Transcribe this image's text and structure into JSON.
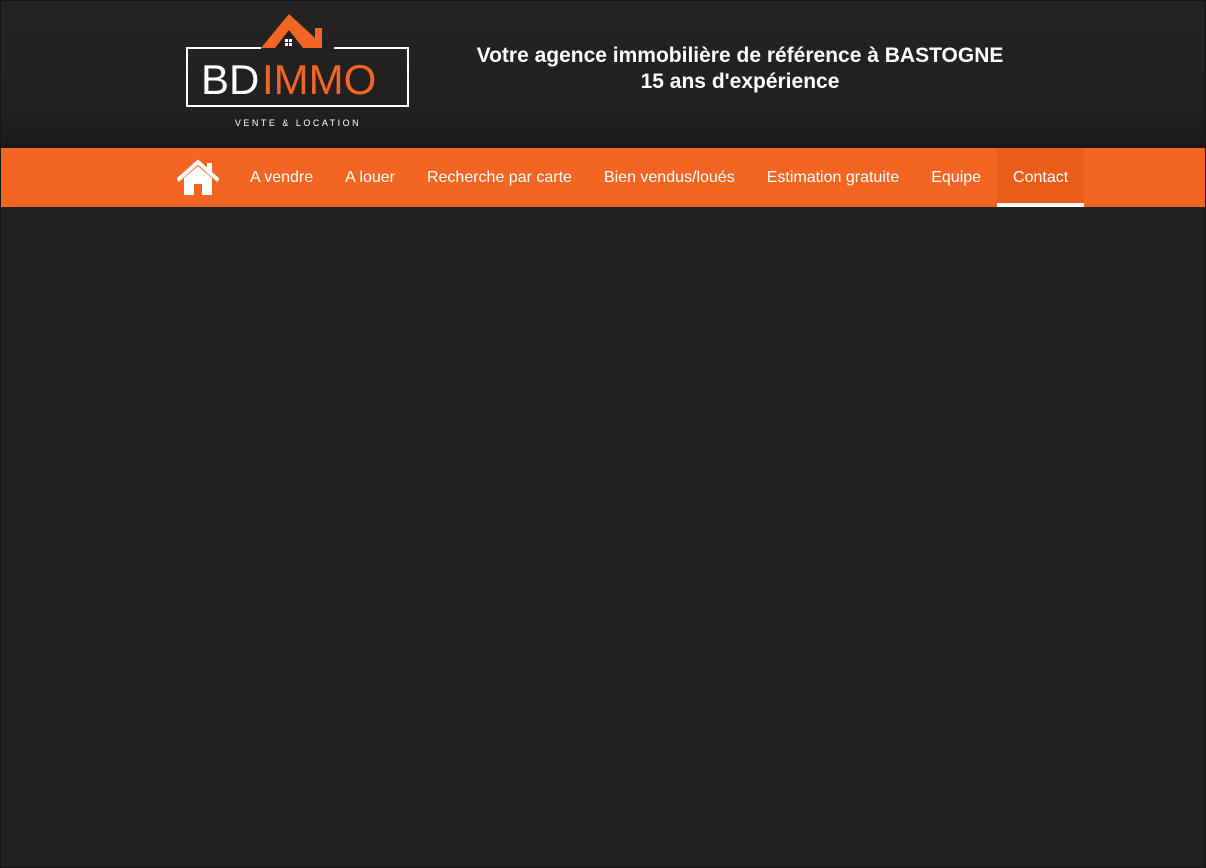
{
  "brand": {
    "logo_text_bd": "BD",
    "logo_text_immo": "IMMO",
    "logo_subtitle": "VENTE & LOCATION",
    "accent_color": "#f26522"
  },
  "header": {
    "tagline_line1": "Votre agence immobilière de référence à BASTOGNE",
    "tagline_line2": "15 ans d'expérience"
  },
  "nav": {
    "home_icon": "home-icon",
    "items": [
      {
        "label": "A vendre"
      },
      {
        "label": "A louer"
      },
      {
        "label": "Recherche par carte"
      },
      {
        "label": "Bien vendus/loués"
      },
      {
        "label": "Estimation gratuite"
      },
      {
        "label": "Equipe"
      },
      {
        "label": "Contact",
        "active": true
      }
    ]
  }
}
